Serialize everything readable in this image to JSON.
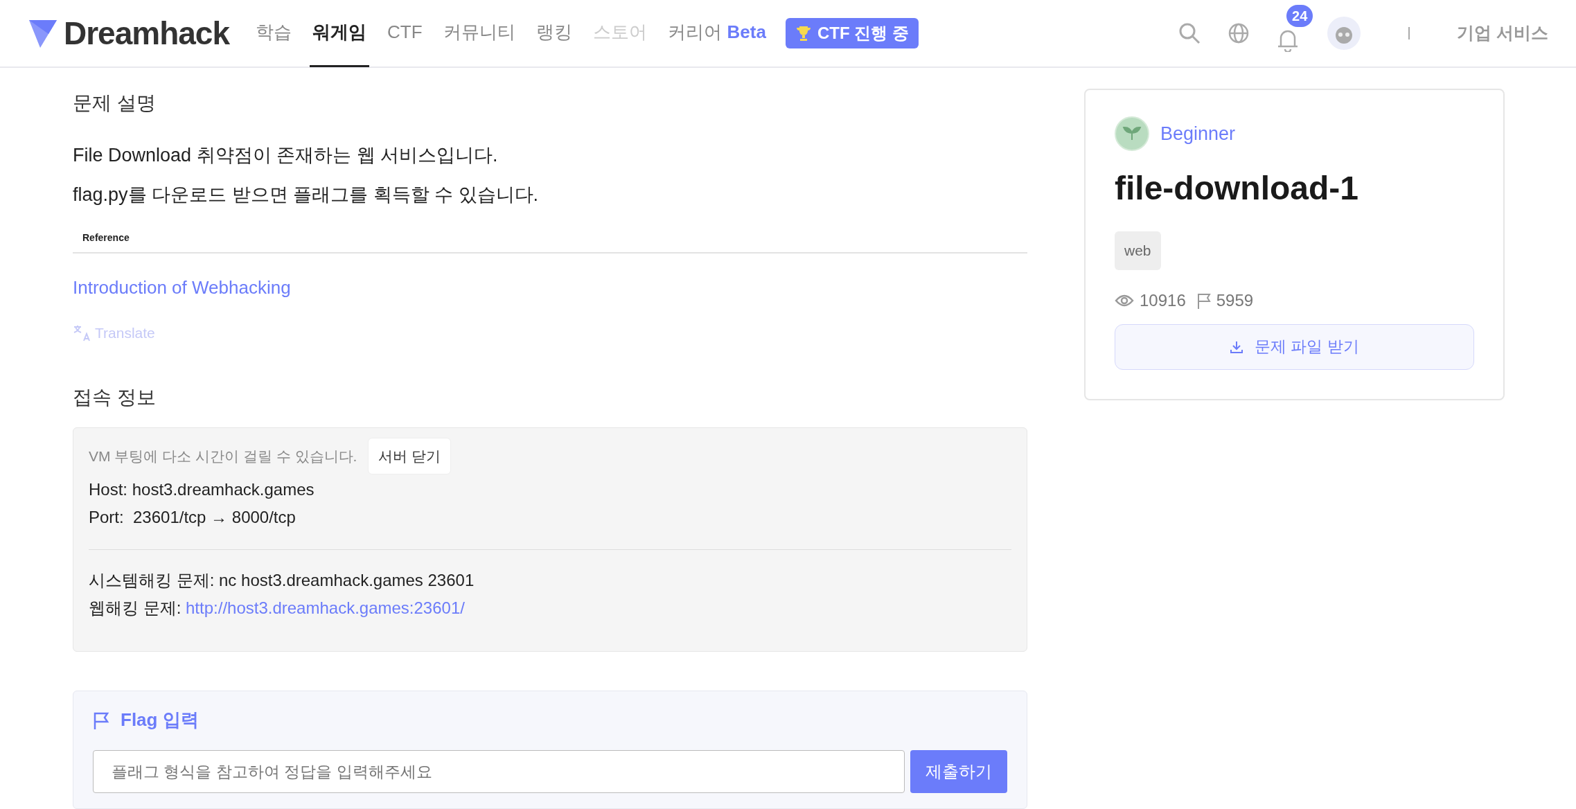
{
  "logo": {
    "text": "Dreamhack"
  },
  "nav": [
    {
      "label": "학습",
      "selected": false,
      "disabled": false
    },
    {
      "label": "워게임",
      "selected": true,
      "disabled": false
    },
    {
      "label": "CTF",
      "selected": false,
      "disabled": false
    },
    {
      "label": "커뮤니티",
      "selected": false,
      "disabled": false
    },
    {
      "label": "랭킹",
      "selected": false,
      "disabled": false
    },
    {
      "label": "스토어",
      "selected": false,
      "disabled": true
    },
    {
      "label": "커리어",
      "badge": "Beta",
      "selected": false,
      "disabled": false
    }
  ],
  "ctf_button": {
    "label": "CTF 진행 중"
  },
  "notifications": {
    "count": "24"
  },
  "enterprise_link": "기업 서비스",
  "description": {
    "title": "문제 설명",
    "paragraphs": [
      "File Download 취약점이 존재하는 웹 서비스입니다.",
      "flag.py를 다운로드 받으면 플래그를 획득할 수 있습니다."
    ],
    "reference_label": "Reference",
    "reference_link": "Introduction of Webhacking",
    "translate": "Translate"
  },
  "access": {
    "title": "접속 정보",
    "notice": "VM 부팅에 다소 시간이 걸릴 수 있습니다.",
    "close_button": "서버 닫기",
    "host": "Host: host3.dreamhack.games",
    "port": "Port:  23601/tcp → 8000/tcp",
    "lines": [
      {
        "kind": "text",
        "label": "시스템해킹 문제: ",
        "value": "nc host3.dreamhack.games 23601"
      },
      {
        "kind": "link",
        "label": "웹해킹 문제: ",
        "value": "http://host3.dreamhack.games:23601/"
      }
    ]
  },
  "flag": {
    "title": "Flag 입력",
    "placeholder": "플래그 형식을 참고하여 정답을 입력해주세요",
    "submit": "제출하기"
  },
  "challenge": {
    "level": "Beginner",
    "title": "file-download-1",
    "tags": [
      "web"
    ],
    "views": "10916",
    "solves": "5959",
    "download_button": "문제 파일 받기"
  }
}
